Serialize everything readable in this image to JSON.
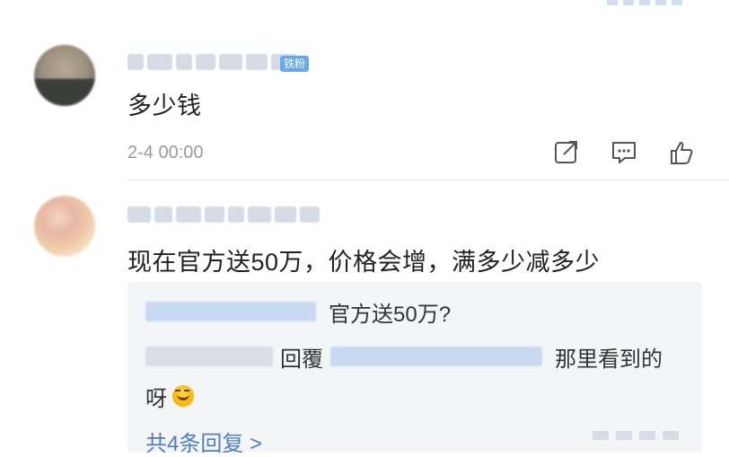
{
  "comments": [
    {
      "badge": "铁粉",
      "text": "多少钱",
      "timestamp": "2-4 00:00",
      "actions": [
        "share-icon",
        "reply-icon",
        "like-icon"
      ]
    },
    {
      "text": "现在官方送50万，价格会增，满多少减多少",
      "replies": [
        {
          "content": "官方送50万?"
        },
        {
          "reply_word": "回覆",
          "content_part1": "那里看到的",
          "content_part2": "呀"
        }
      ],
      "more_replies": "共4条回复 >"
    }
  ],
  "colors": {
    "badge": "#6aa9e8",
    "timestamp": "#9a9aa4",
    "link": "#4f7fc2",
    "reply_bg": "#f4f5f7"
  }
}
